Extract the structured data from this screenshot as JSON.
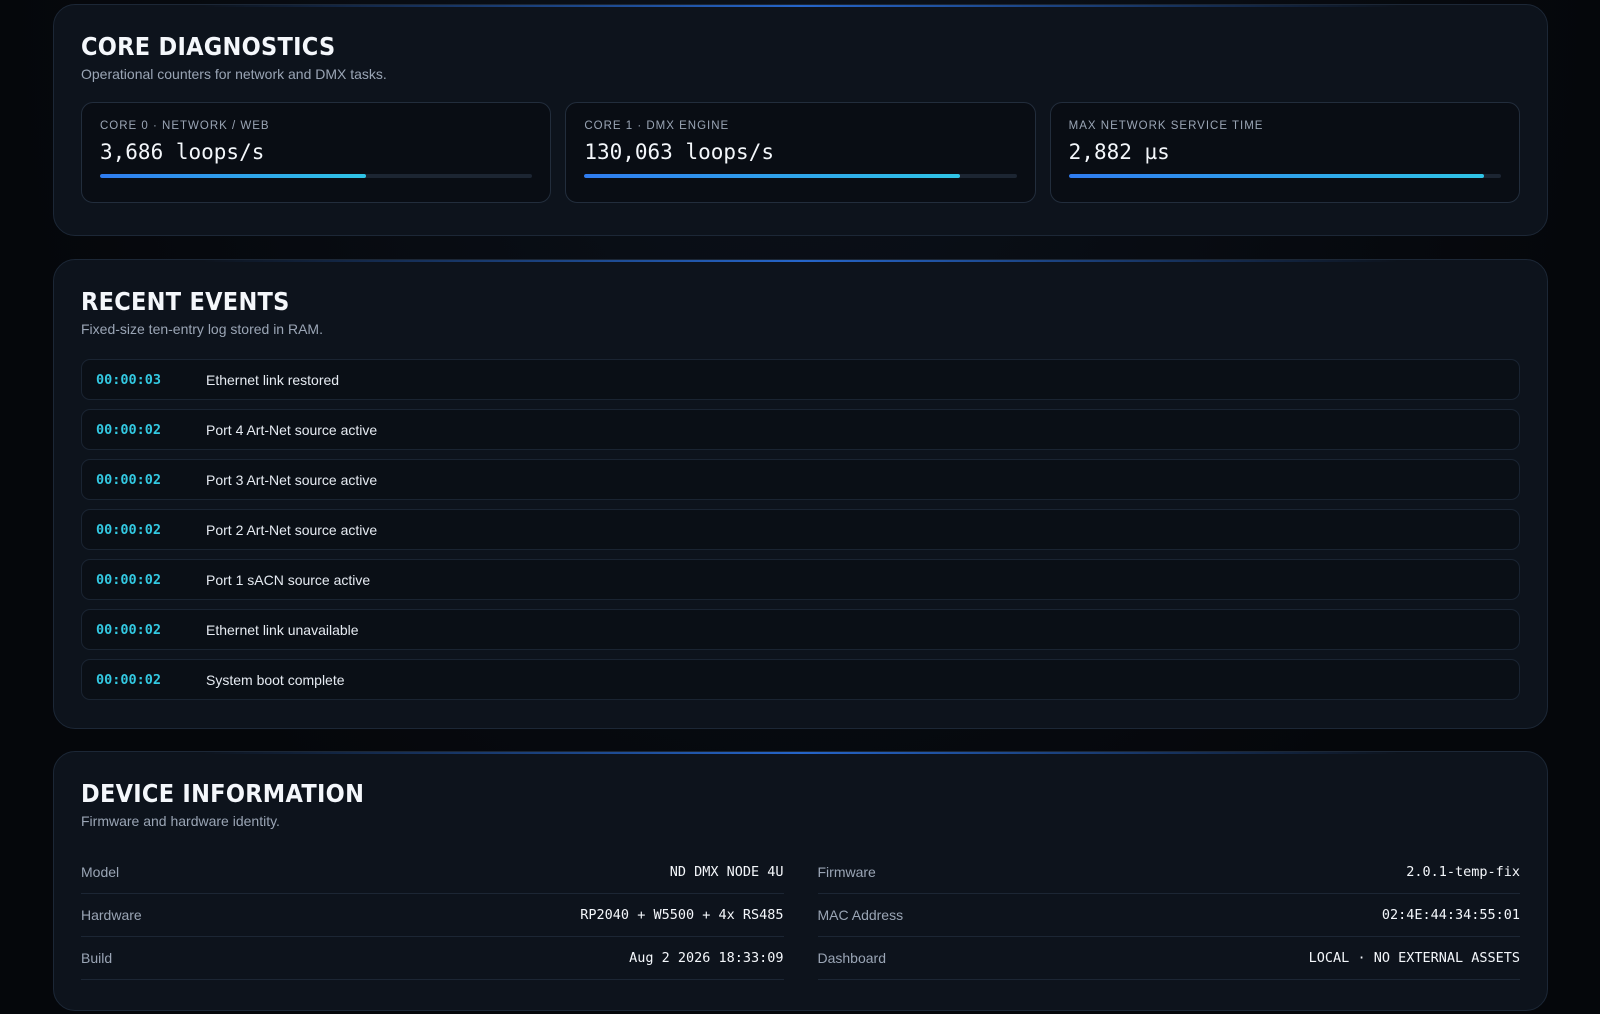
{
  "diagnostics": {
    "title": "Core Diagnostics",
    "subtitle": "Operational counters for network and DMX tasks.",
    "cards": [
      {
        "label": "Core 0 · Network / Web",
        "value": "3,686 loops/s",
        "fill": 0.615
      },
      {
        "label": "Core 1 · DMX Engine",
        "value": "130,063 loops/s",
        "fill": 0.868
      },
      {
        "label": "Max Network Service Time",
        "value": "2,882 µs",
        "fill": 0.96
      }
    ]
  },
  "events": {
    "title": "Recent Events",
    "subtitle": "Fixed-size ten-entry log stored in RAM.",
    "items": [
      {
        "time": "00:00:03",
        "text": "Ethernet link restored"
      },
      {
        "time": "00:00:02",
        "text": "Port 4 Art-Net source active"
      },
      {
        "time": "00:00:02",
        "text": "Port 3 Art-Net source active"
      },
      {
        "time": "00:00:02",
        "text": "Port 2 Art-Net source active"
      },
      {
        "time": "00:00:02",
        "text": "Port 1 sACN source active"
      },
      {
        "time": "00:00:02",
        "text": "Ethernet link unavailable"
      },
      {
        "time": "00:00:02",
        "text": "System boot complete"
      }
    ]
  },
  "device": {
    "title": "Device Information",
    "subtitle": "Firmware and hardware identity.",
    "left": [
      {
        "key": "Model",
        "value": "ND DMX NODE 4U"
      },
      {
        "key": "Hardware",
        "value": "RP2040 + W5500 + 4x RS485"
      },
      {
        "key": "Build",
        "value": "Aug 2 2026 18:33:09"
      }
    ],
    "right": [
      {
        "key": "Firmware",
        "value": "2.0.1-temp-fix"
      },
      {
        "key": "MAC Address",
        "value": "02:4E:44:34:55:01"
      },
      {
        "key": "Dashboard",
        "value": "LOCAL · NO EXTERNAL ASSETS"
      }
    ]
  },
  "colors": {
    "accent": "#2f7cf0",
    "accent2": "#2fc4e6",
    "timestamp": "#33c9e2",
    "panel": "#0d131c"
  }
}
